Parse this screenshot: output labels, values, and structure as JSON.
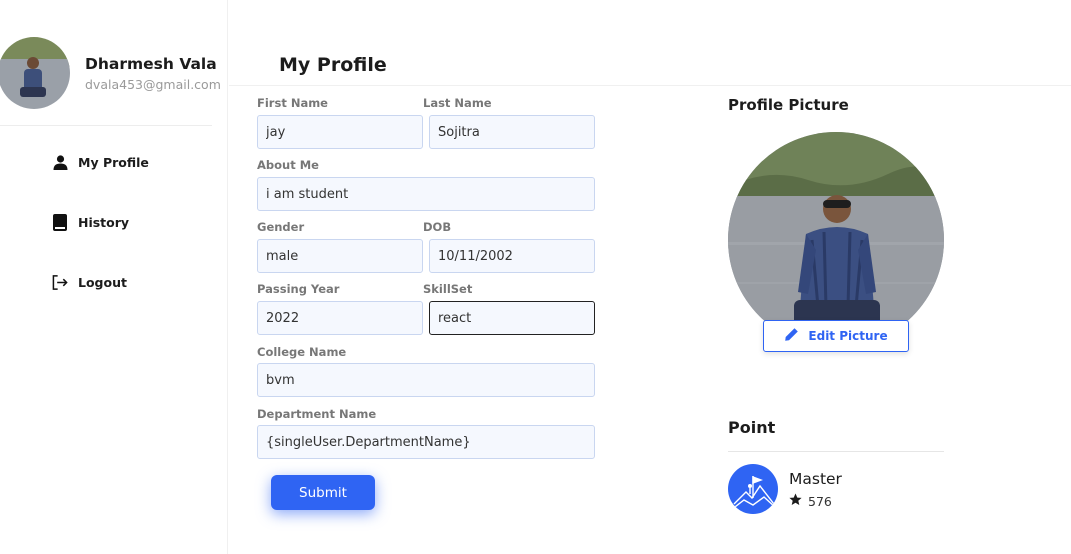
{
  "user": {
    "name": "Dharmesh Vala",
    "email": "dvala453@gmail.com"
  },
  "sidebar": {
    "items": [
      {
        "label": "My Profile",
        "icon": "user-icon"
      },
      {
        "label": "History",
        "icon": "book-icon"
      },
      {
        "label": "Logout",
        "icon": "logout-icon"
      }
    ]
  },
  "header": {
    "title": "My Profile"
  },
  "form": {
    "first_name": {
      "label": "First Name",
      "value": "jay"
    },
    "last_name": {
      "label": "Last Name",
      "value": "Sojitra"
    },
    "about_me": {
      "label": "About Me",
      "value": "i am student"
    },
    "gender": {
      "label": "Gender",
      "value": "male"
    },
    "dob": {
      "label": "DOB",
      "value": "10/11/2002"
    },
    "passing_year": {
      "label": "Passing Year",
      "value": "2022"
    },
    "skillset": {
      "label": "SkillSet",
      "value": "react"
    },
    "college_name": {
      "label": "College Name",
      "value": "bvm"
    },
    "department_name": {
      "label": "Department Name",
      "value": "{singleUser.DepartmentName}"
    },
    "submit_label": "Submit"
  },
  "profile_picture": {
    "title": "Profile Picture",
    "edit_label": "Edit Picture"
  },
  "point": {
    "title": "Point",
    "rank": "Master",
    "score": "576"
  },
  "colors": {
    "accent": "#2f64f3",
    "input_bg": "#f5f8fe",
    "input_border": "#c9d6f0"
  }
}
